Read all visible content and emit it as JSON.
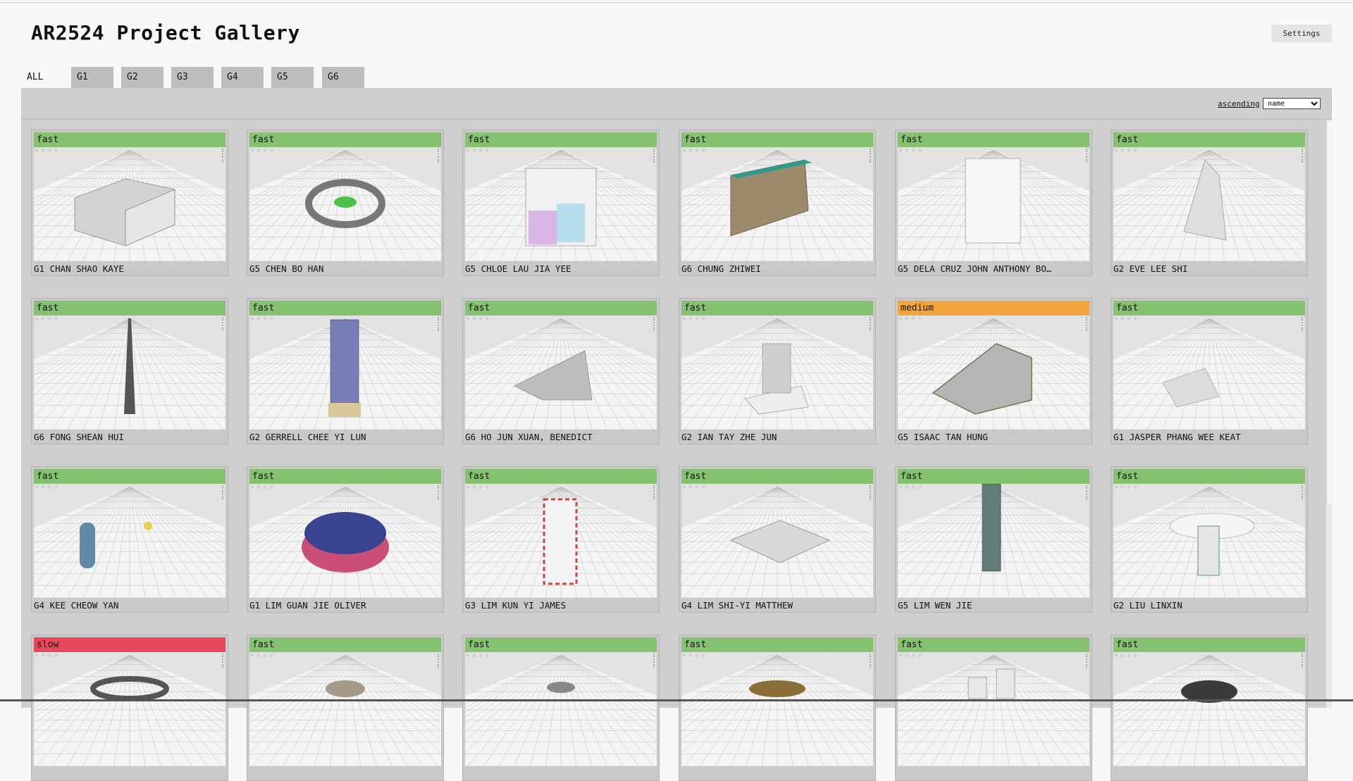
{
  "header": {
    "title": "AR2524 Project Gallery",
    "settings_label": "Settings"
  },
  "tabs": [
    {
      "label": "ALL",
      "active": true
    },
    {
      "label": "G1",
      "active": false
    },
    {
      "label": "G2",
      "active": false
    },
    {
      "label": "G3",
      "active": false
    },
    {
      "label": "G4",
      "active": false
    },
    {
      "label": "G5",
      "active": false
    },
    {
      "label": "G6",
      "active": false
    }
  ],
  "toolbar": {
    "order_label": "ascending",
    "sort_selected": "name"
  },
  "colors": {
    "fast": "#86c172",
    "medium": "#f2a53a",
    "slow": "#e9475b",
    "panel": "#cfcfcf"
  },
  "cards": [
    {
      "speed": "fast",
      "caption": "G1 CHAN SHAO KAYE",
      "model": "box"
    },
    {
      "speed": "fast",
      "caption": "G5 CHEN BO HAN",
      "model": "ring"
    },
    {
      "speed": "fast",
      "caption": "G5 CHLOE LAU JIA YEE",
      "model": "glassbox"
    },
    {
      "speed": "fast",
      "caption": "G6 CHUNG ZHIWEI",
      "model": "slab"
    },
    {
      "speed": "fast",
      "caption": "G5 DELA CRUZ JOHN ANTHONY BO…",
      "model": "stack"
    },
    {
      "speed": "fast",
      "caption": "G2 EVE LEE SHI",
      "model": "cone"
    },
    {
      "speed": "fast",
      "caption": "G6 FONG SHEAN HUI",
      "model": "spire"
    },
    {
      "speed": "fast",
      "caption": "G2 GERRELL CHEE YI LUN",
      "model": "twist"
    },
    {
      "speed": "fast",
      "caption": "G6 HO JUN XUAN, BENEDICT",
      "model": "wave"
    },
    {
      "speed": "fast",
      "caption": "G2 IAN TAY ZHE JUN",
      "model": "sculpt"
    },
    {
      "speed": "medium",
      "caption": "G5 ISAAC TAN HUNG",
      "model": "terrace"
    },
    {
      "speed": "fast",
      "caption": "G1 JASPER PHANG WEE KEAT",
      "model": "ripple"
    },
    {
      "speed": "fast",
      "caption": "G4 KEE CHEOW YAN",
      "model": "capsule"
    },
    {
      "speed": "fast",
      "caption": "G1 LIM GUAN JIE OLIVER",
      "model": "torus"
    },
    {
      "speed": "fast",
      "caption": "G3 LIM KUN YI JAMES",
      "model": "redtower"
    },
    {
      "speed": "fast",
      "caption": "G4 LIM SHI-YI MATTHEW",
      "model": "canopy"
    },
    {
      "speed": "fast",
      "caption": "G5 LIM WEN JIE",
      "model": "tall"
    },
    {
      "speed": "fast",
      "caption": "G2 LIU LINXIN",
      "model": "cluster"
    },
    {
      "speed": "slow",
      "caption": "",
      "model": "partial-ring"
    },
    {
      "speed": "fast",
      "caption": "",
      "model": "partial-dome"
    },
    {
      "speed": "fast",
      "caption": "",
      "model": "partial-spike"
    },
    {
      "speed": "fast",
      "caption": "",
      "model": "partial-disc"
    },
    {
      "speed": "fast",
      "caption": "",
      "model": "partial-towers"
    },
    {
      "speed": "fast",
      "caption": "",
      "model": "partial-dark"
    }
  ]
}
